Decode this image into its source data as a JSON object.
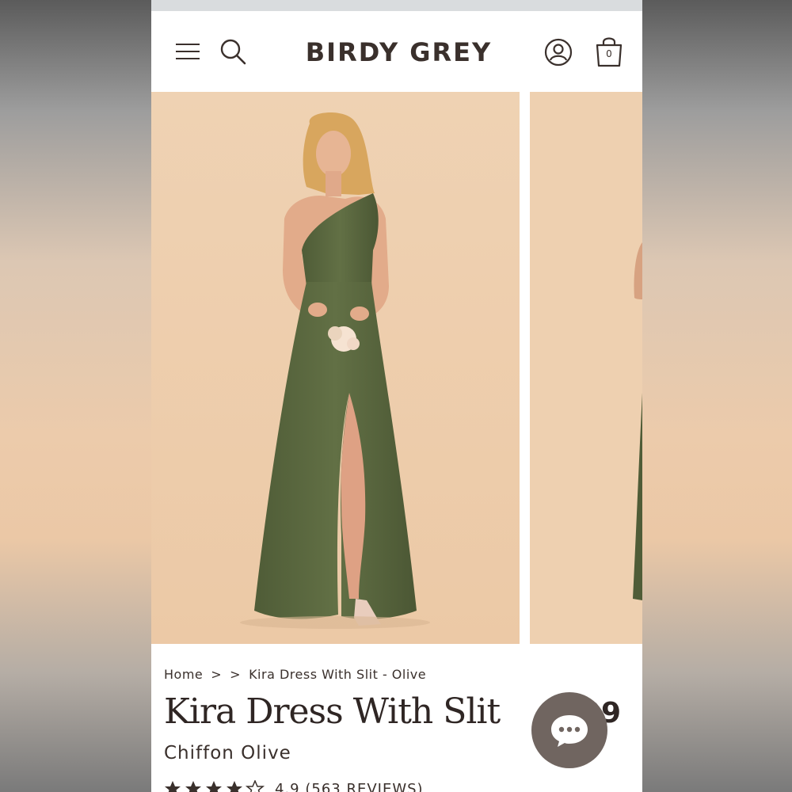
{
  "brand": {
    "name": "BIRDY GREY"
  },
  "header": {
    "menu_icon": "hamburger-menu-icon",
    "search_icon": "search-icon",
    "account_icon": "account-icon",
    "bag_icon": "shopping-bag-icon",
    "bag_count": "0"
  },
  "breadcrumb": {
    "home": "Home",
    "separator": ">",
    "current": "Kira Dress With Slit - Olive"
  },
  "product": {
    "title": "Kira Dress With Slit",
    "subtitle": "Chiffon Olive",
    "price_visible": "99",
    "rating_text": "4.9 (563 REVIEWS)",
    "rating": 4.9,
    "rating_max": 5
  },
  "chat": {
    "icon": "chat-bubble-icon"
  },
  "colors": {
    "brand_text": "#3a302c",
    "photo_background": "#eed0b0",
    "dress_olive": "#5b6840",
    "chat_button": "#706560"
  }
}
